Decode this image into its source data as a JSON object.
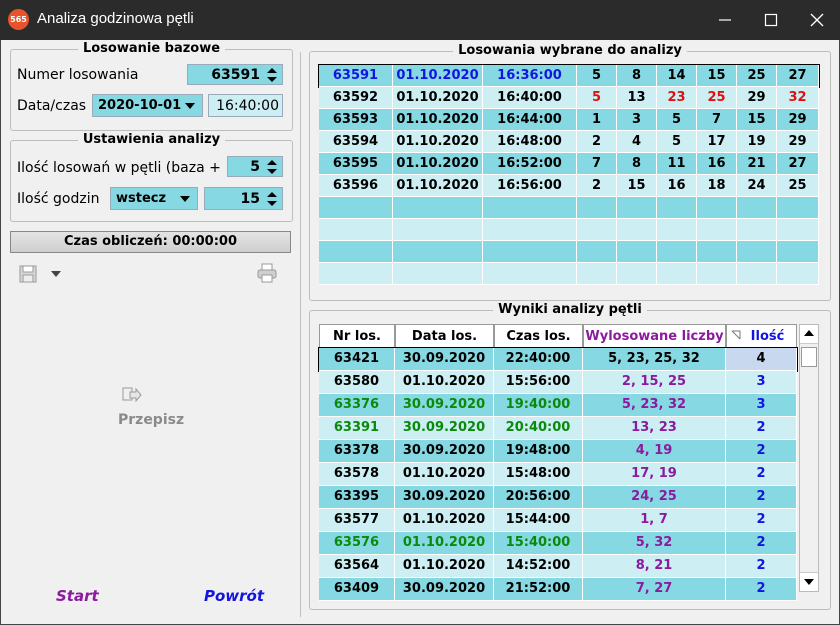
{
  "window": {
    "title": "Analiza godzinowa pętli",
    "icon_text": "565"
  },
  "base": {
    "legend": "Losowanie bazowe",
    "draw_label": "Numer losowania",
    "draw_value": "63591",
    "datetime_label": "Data/czas",
    "date_value": "2020-10-01",
    "time_value": "16:40:00"
  },
  "settings": {
    "legend": "Ustawienia analizy",
    "count_label": "Ilość losowań w pętli (baza +",
    "count_value": "5",
    "hours_label": "Ilość godzin",
    "direction_value": "wstecz",
    "hours_value": "15"
  },
  "calc_time": "Czas obliczeń: 00:00:00",
  "copy_button": "Przepisz",
  "start_button": "Start",
  "back_button": "Powrót",
  "selected": {
    "legend": "Losowania wybrane do analizy",
    "rows": [
      {
        "nr": "63591",
        "date": "01.10.2020",
        "time": "16:36:00",
        "nums": [
          "5",
          "8",
          "14",
          "15",
          "25",
          "27"
        ],
        "hl": []
      },
      {
        "nr": "63592",
        "date": "01.10.2020",
        "time": "16:40:00",
        "nums": [
          "5",
          "13",
          "23",
          "25",
          "29",
          "32"
        ],
        "hl": [
          0,
          2,
          3,
          5
        ]
      },
      {
        "nr": "63593",
        "date": "01.10.2020",
        "time": "16:44:00",
        "nums": [
          "1",
          "3",
          "5",
          "7",
          "15",
          "29"
        ],
        "hl": []
      },
      {
        "nr": "63594",
        "date": "01.10.2020",
        "time": "16:48:00",
        "nums": [
          "2",
          "4",
          "5",
          "17",
          "19",
          "29"
        ],
        "hl": []
      },
      {
        "nr": "63595",
        "date": "01.10.2020",
        "time": "16:52:00",
        "nums": [
          "7",
          "8",
          "11",
          "16",
          "21",
          "27"
        ],
        "hl": []
      },
      {
        "nr": "63596",
        "date": "01.10.2020",
        "time": "16:56:00",
        "nums": [
          "2",
          "15",
          "16",
          "18",
          "24",
          "25"
        ],
        "hl": []
      }
    ]
  },
  "results": {
    "legend": "Wyniki analizy pętli",
    "headers": [
      "Nr los.",
      "Data los.",
      "Czas los.",
      "Wylosowane liczby",
      "Ilość"
    ],
    "rows": [
      {
        "nr": "63421",
        "date": "30.09.2020",
        "time": "22:40:00",
        "nums": "5, 23, 25, 32",
        "count": "4",
        "green": false
      },
      {
        "nr": "63580",
        "date": "01.10.2020",
        "time": "15:56:00",
        "nums": "2, 15, 25",
        "count": "3",
        "green": false
      },
      {
        "nr": "63376",
        "date": "30.09.2020",
        "time": "19:40:00",
        "nums": "5, 23, 32",
        "count": "3",
        "green": true
      },
      {
        "nr": "63391",
        "date": "30.09.2020",
        "time": "20:40:00",
        "nums": "13, 23",
        "count": "2",
        "green": true
      },
      {
        "nr": "63378",
        "date": "30.09.2020",
        "time": "19:48:00",
        "nums": "4, 19",
        "count": "2",
        "green": false
      },
      {
        "nr": "63578",
        "date": "01.10.2020",
        "time": "15:48:00",
        "nums": "17, 19",
        "count": "2",
        "green": false
      },
      {
        "nr": "63395",
        "date": "30.09.2020",
        "time": "20:56:00",
        "nums": "24, 25",
        "count": "2",
        "green": false
      },
      {
        "nr": "63577",
        "date": "01.10.2020",
        "time": "15:44:00",
        "nums": "1, 7",
        "count": "2",
        "green": false
      },
      {
        "nr": "63576",
        "date": "01.10.2020",
        "time": "15:40:00",
        "nums": "5, 32",
        "count": "2",
        "green": true
      },
      {
        "nr": "63564",
        "date": "01.10.2020",
        "time": "14:52:00",
        "nums": "8, 21",
        "count": "2",
        "green": false
      },
      {
        "nr": "63409",
        "date": "30.09.2020",
        "time": "21:52:00",
        "nums": "7, 27",
        "count": "2",
        "green": false
      }
    ]
  },
  "colors": {
    "cyan": "#86d9e2",
    "light_cyan": "#cdeef2",
    "purple": "#8b1a9e",
    "blue": "#1414e0",
    "green": "#0a8a0a",
    "red": "#e01010"
  }
}
